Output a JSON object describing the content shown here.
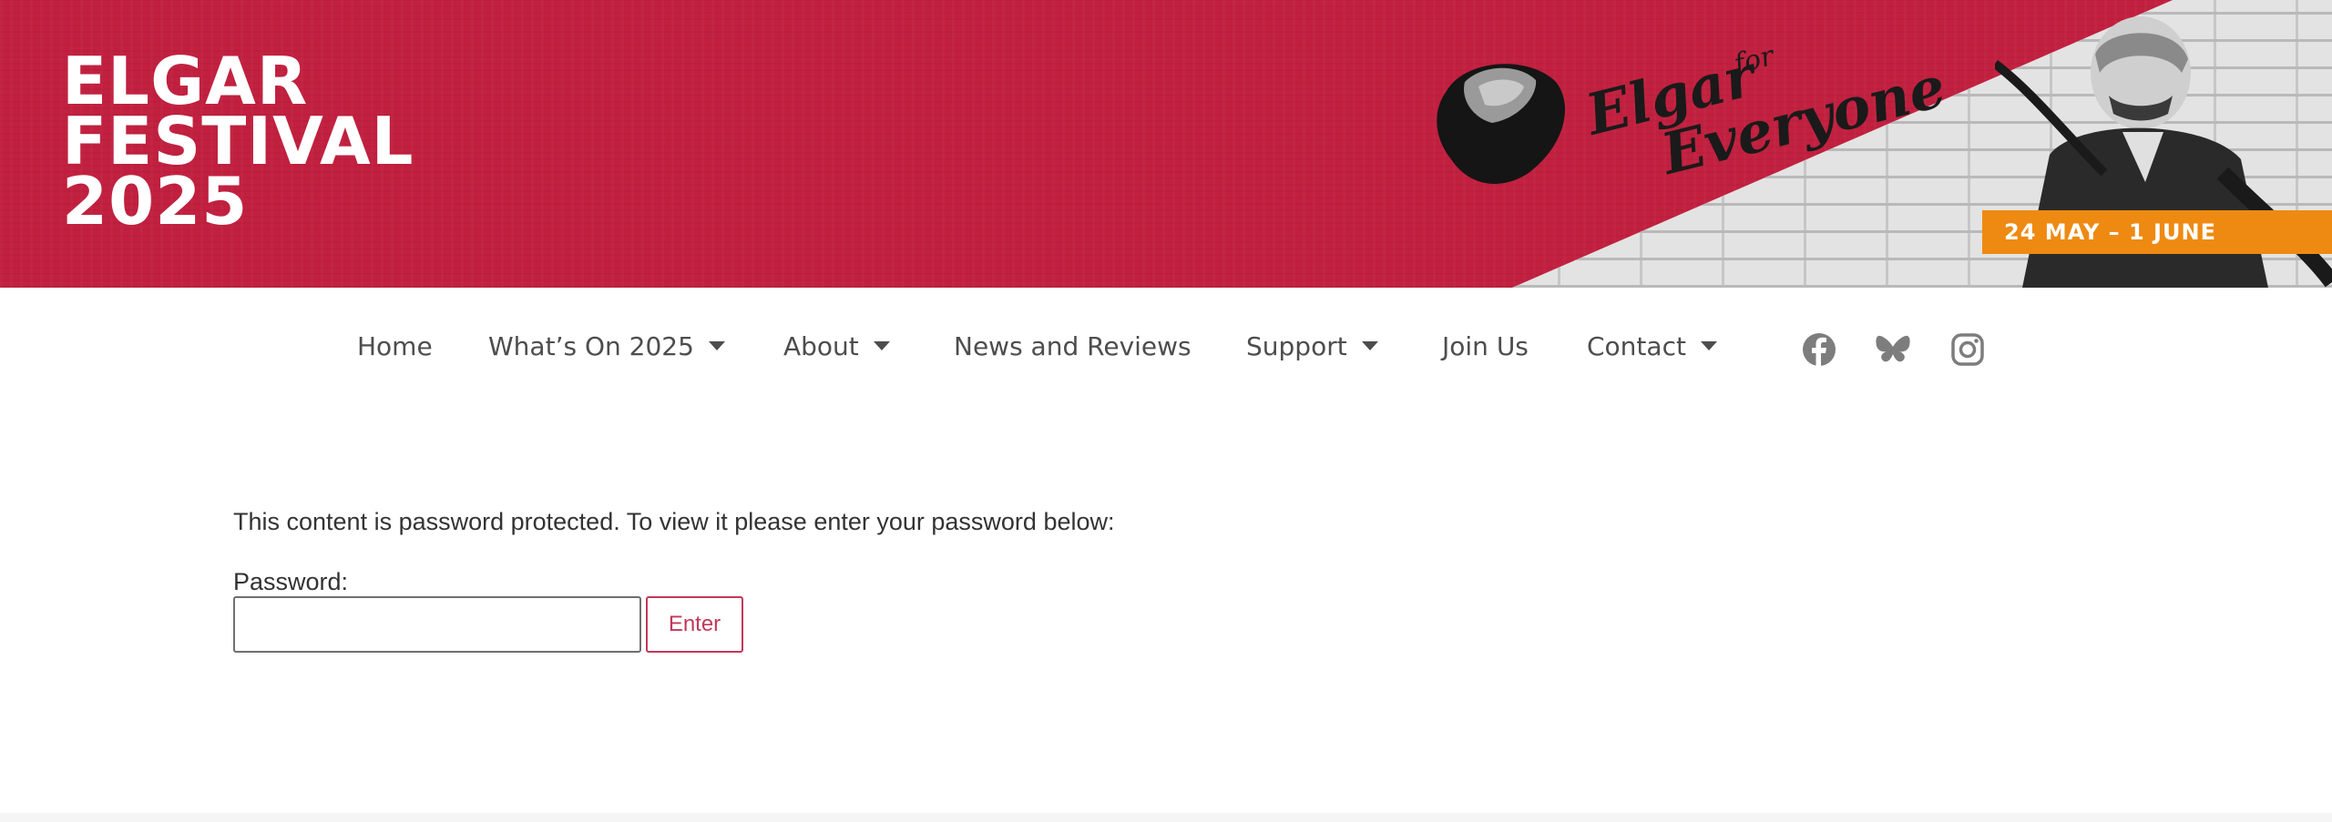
{
  "banner": {
    "title_lines": [
      "ELGAR",
      "FESTIVAL",
      "2025"
    ],
    "tagline": {
      "elgar": "Elgar",
      "for": "for",
      "everyone": "Everyone"
    },
    "dates": "24 MAY – 1 JUNE",
    "colors": {
      "brand_red": "#c2203f",
      "date_orange": "#ee8a11"
    }
  },
  "nav": {
    "items": [
      {
        "label": "Home",
        "has_dropdown": false
      },
      {
        "label": "What’s On 2025",
        "has_dropdown": true
      },
      {
        "label": "About",
        "has_dropdown": true
      },
      {
        "label": "News and Reviews",
        "has_dropdown": false
      },
      {
        "label": "Support",
        "has_dropdown": true
      },
      {
        "label": "Join Us",
        "has_dropdown": false
      },
      {
        "label": "Contact",
        "has_dropdown": true
      }
    ],
    "social_icons": [
      "facebook-icon",
      "bluesky-icon",
      "instagram-icon"
    ]
  },
  "content": {
    "message": "This content is password protected. To view it please enter your password below:",
    "password_label": "Password:",
    "password_value": "",
    "enter_label": "Enter",
    "accent_color": "#c2385a"
  }
}
